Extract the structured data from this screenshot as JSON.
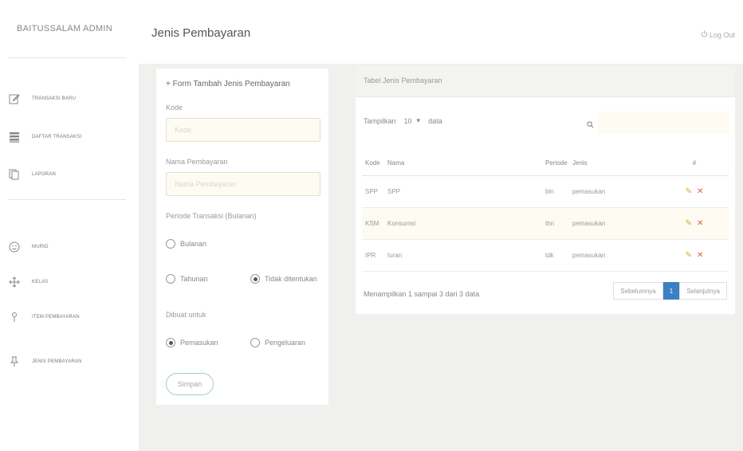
{
  "sidebar": {
    "brand": "BAITUSSALAM ADMIN",
    "items": [
      {
        "label": "TRANSAKSI BARU",
        "icon": "edit-icon"
      },
      {
        "label": "DAFTAR TRANSAKSI",
        "icon": "list-icon"
      },
      {
        "label": "LAPORAN",
        "icon": "copy-icon"
      },
      {
        "label": "MURID",
        "icon": "smile-icon"
      },
      {
        "label": "KELAS",
        "icon": "move-icon"
      },
      {
        "label": "ITEM PEMBAYARAN",
        "icon": "pin-icon"
      },
      {
        "label": "JENIS PEMBAYARAN",
        "icon": "pushpin-icon"
      }
    ]
  },
  "header": {
    "title": "Jenis Pembayaran",
    "logout": "Log Out"
  },
  "form": {
    "heading": "+ Form Tambah Jenis Pembayaran",
    "kode_label": "Kode",
    "kode_placeholder": "Kode",
    "nama_label": "Nama Pembayaran",
    "nama_placeholder": "Nama Pembayaran",
    "periode_label": "Periode Transaksi (Bulanan)",
    "periode_options": [
      "Bulanan",
      "Tahunan",
      "Tidak ditentukan"
    ],
    "dibuat_label": "Dibuat untuk",
    "dibuat_options": [
      "Pemasukan",
      "Pengeluaran"
    ],
    "save_label": "Simpan"
  },
  "table_card": {
    "title": "Tabel Jenis Pembayaran",
    "show_label": "Tampilkan",
    "length_value": "10",
    "length_suffix": "data",
    "columns": [
      "Kode",
      "Nama",
      "Periode",
      "Jenis",
      "#"
    ],
    "rows": [
      {
        "kode": "SPP",
        "nama": "SPP",
        "periode": "bln",
        "jenis": "pemasukan"
      },
      {
        "kode": "KSM",
        "nama": "Konsumsi",
        "periode": "thn",
        "jenis": "pemasukan"
      },
      {
        "kode": "IPR",
        "nama": "Iuran",
        "periode": "tdk",
        "jenis": "pemasukan"
      }
    ],
    "info": "Menampilkan 1 sampai 3 dari 3 data",
    "pagination": {
      "prev": "Sebelumnya",
      "current": "1",
      "next": "Selanjutnya"
    }
  },
  "colors": {
    "accent": "#3b7fc4",
    "edit": "#e8a030",
    "delete": "#e05a4a",
    "save_border": "#9fd3a8"
  }
}
